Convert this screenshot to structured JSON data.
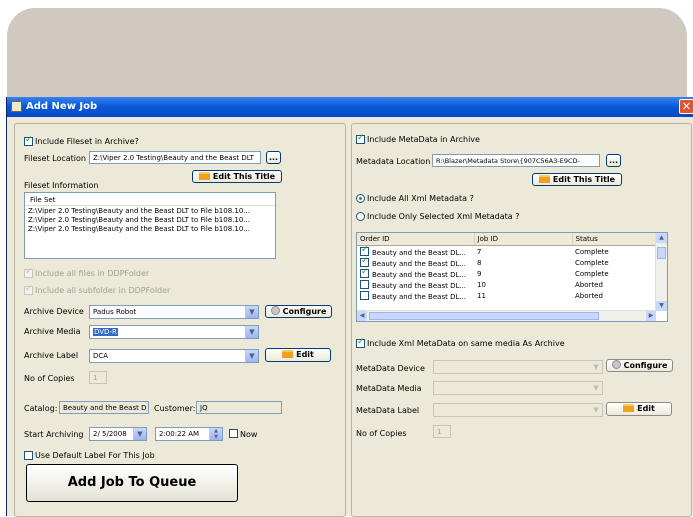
{
  "dialog": {
    "title": "Add New Job",
    "close": "✕"
  },
  "left": {
    "include_fileset": "Include Fileset in Archive?",
    "fileset_location_label": "Fileset Location",
    "fileset_location": "Z:\\Viper 2.0 Testing\\Beauty and the Beast DLT",
    "browse": "...",
    "edit_title": "Edit This Title",
    "fileset_info_label": "Fileset Information",
    "fileset_header": "File Set",
    "files": [
      "Z:\\Viper 2.0 Testing\\Beauty and the Beast DLT to File b108.10...",
      "Z:\\Viper 2.0 Testing\\Beauty and the Beast DLT to File b108.10...",
      "Z:\\Viper 2.0 Testing\\Beauty and the Beast DLT to File b108.10..."
    ],
    "include_all_files": "Include all files in DDPFolder",
    "include_all_subfolder": "Include all subfolder in DDPFolder",
    "archive_device_label": "Archive Device",
    "archive_device": "Padus Robot",
    "configure": "Configure",
    "archive_media_label": "Archive Media",
    "archive_media": "DVD-R",
    "archive_label_label": "Archive Label",
    "archive_label": "DCA",
    "edit": "Edit",
    "copies_label": "No of Copies",
    "copies": "1",
    "catalog_label": "Catalog:",
    "catalog": "Beauty and the Beast D",
    "customer_label": "Customer:",
    "customer": "JQ",
    "start_label": "Start Archiving",
    "start_date": "2/ 5/2008",
    "start_time": "2:00:22 AM",
    "now": "Now",
    "default_label": "Use Default Label For This Job",
    "add_job": "Add Job To Queue"
  },
  "right": {
    "include_metadata": "Include MetaData in Archive",
    "metadata_location_label": "Metadata Location",
    "metadata_location": "R:\\Blazer\\Metadata Store\\{907C56A3-E9CD-",
    "browse": "...",
    "edit_title": "Edit This Title",
    "radio_all": "Include All Xml Metadata ?",
    "radio_selected": "Include Only Selected Xml Metadata ?",
    "table_headers": [
      "Order ID",
      "Job ID",
      "Status"
    ],
    "rows": [
      {
        "checked": true,
        "order": "Beauty and the Beast DL...",
        "job": "7",
        "status": "Complete"
      },
      {
        "checked": true,
        "order": "Beauty and the Beast DL...",
        "job": "8",
        "status": "Complete"
      },
      {
        "checked": true,
        "order": "Beauty and the Beast DL...",
        "job": "9",
        "status": "Complete"
      },
      {
        "checked": false,
        "order": "Beauty and the Beast DL...",
        "job": "10",
        "status": "Aborted"
      },
      {
        "checked": false,
        "order": "Beauty and the Beast DL...",
        "job": "11",
        "status": "Aborted"
      }
    ],
    "include_xml_same_media": "Include Xml MetaData on same media As Archive",
    "metadata_device_label": "MetaData Device",
    "metadata_media_label": "MetaData Media",
    "metadata_label_label": "MetaData Label",
    "configure": "Configure",
    "edit": "Edit",
    "copies_label": "No of Copies",
    "copies": "1"
  }
}
